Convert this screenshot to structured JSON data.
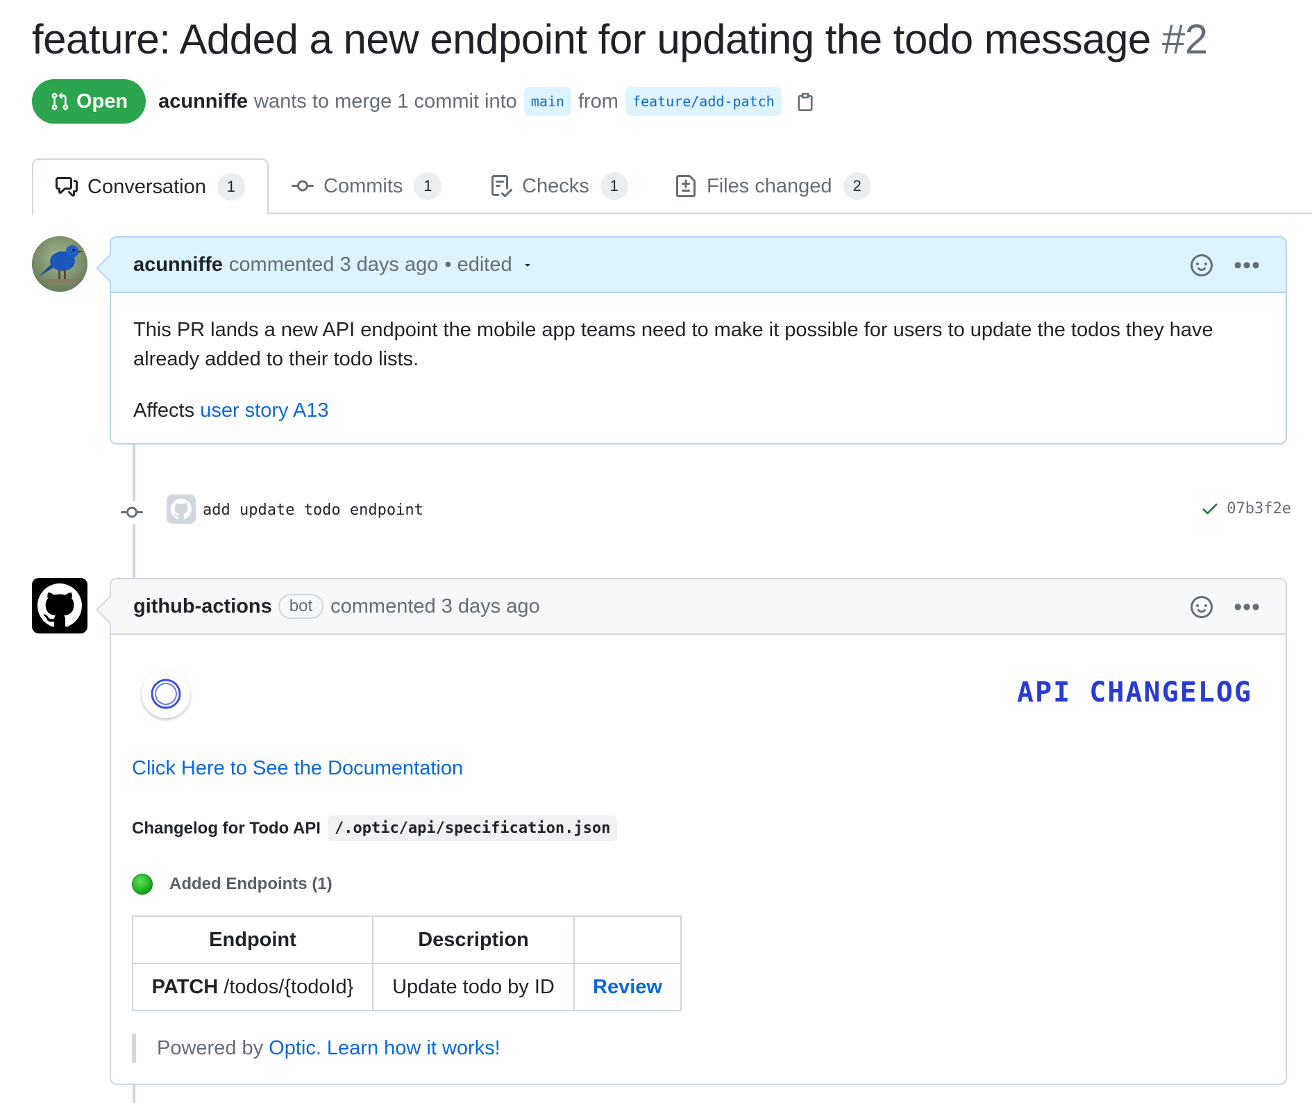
{
  "pr": {
    "title": "feature: Added a new endpoint for updating the todo message",
    "number": "#2",
    "state": "Open",
    "author": "acunniffe",
    "merge_text": "wants to merge 1 commit into",
    "base_branch": "main",
    "from_text": "from",
    "head_branch": "feature/add-patch"
  },
  "tabs": [
    {
      "label": "Conversation",
      "count": "1",
      "icon": "comment-discussion-icon"
    },
    {
      "label": "Commits",
      "count": "1",
      "icon": "git-commit-icon"
    },
    {
      "label": "Checks",
      "count": "1",
      "icon": "checklist-icon"
    },
    {
      "label": "Files changed",
      "count": "2",
      "icon": "file-diff-icon"
    }
  ],
  "comment1": {
    "author": "acunniffe",
    "meta": "commented 3 days ago",
    "edited": "• edited",
    "body_line": "This PR lands a new API endpoint the mobile app teams need to make it possible for users to update the todos they have already added to their todo lists.",
    "affects": "Affects",
    "affects_link": "user story A13"
  },
  "commit": {
    "message": "add update todo endpoint",
    "sha": "07b3f2e"
  },
  "comment2": {
    "author": "github-actions",
    "badge": "bot",
    "meta": "commented 3 days ago",
    "api_changelog": "API CHANGELOG",
    "doc_link": "Click Here to See the Documentation",
    "changelog_label": "Changelog for Todo API",
    "changelog_path": "/.optic/api/specification.json",
    "added_label": "Added Endpoints (1)",
    "table": {
      "headers": [
        "Endpoint",
        "Description",
        ""
      ],
      "rows": [
        {
          "method": "PATCH",
          "path": "/todos/{todoId}",
          "description": "Update todo by ID",
          "action": "Review"
        }
      ]
    },
    "powered_by": "Powered by",
    "powered_link": "Optic.",
    "learn_link": "Learn how it works!"
  },
  "colors": {
    "open_green": "#2da44e",
    "link_blue": "#0969da",
    "api_changelog_blue": "#2a3bd1"
  }
}
